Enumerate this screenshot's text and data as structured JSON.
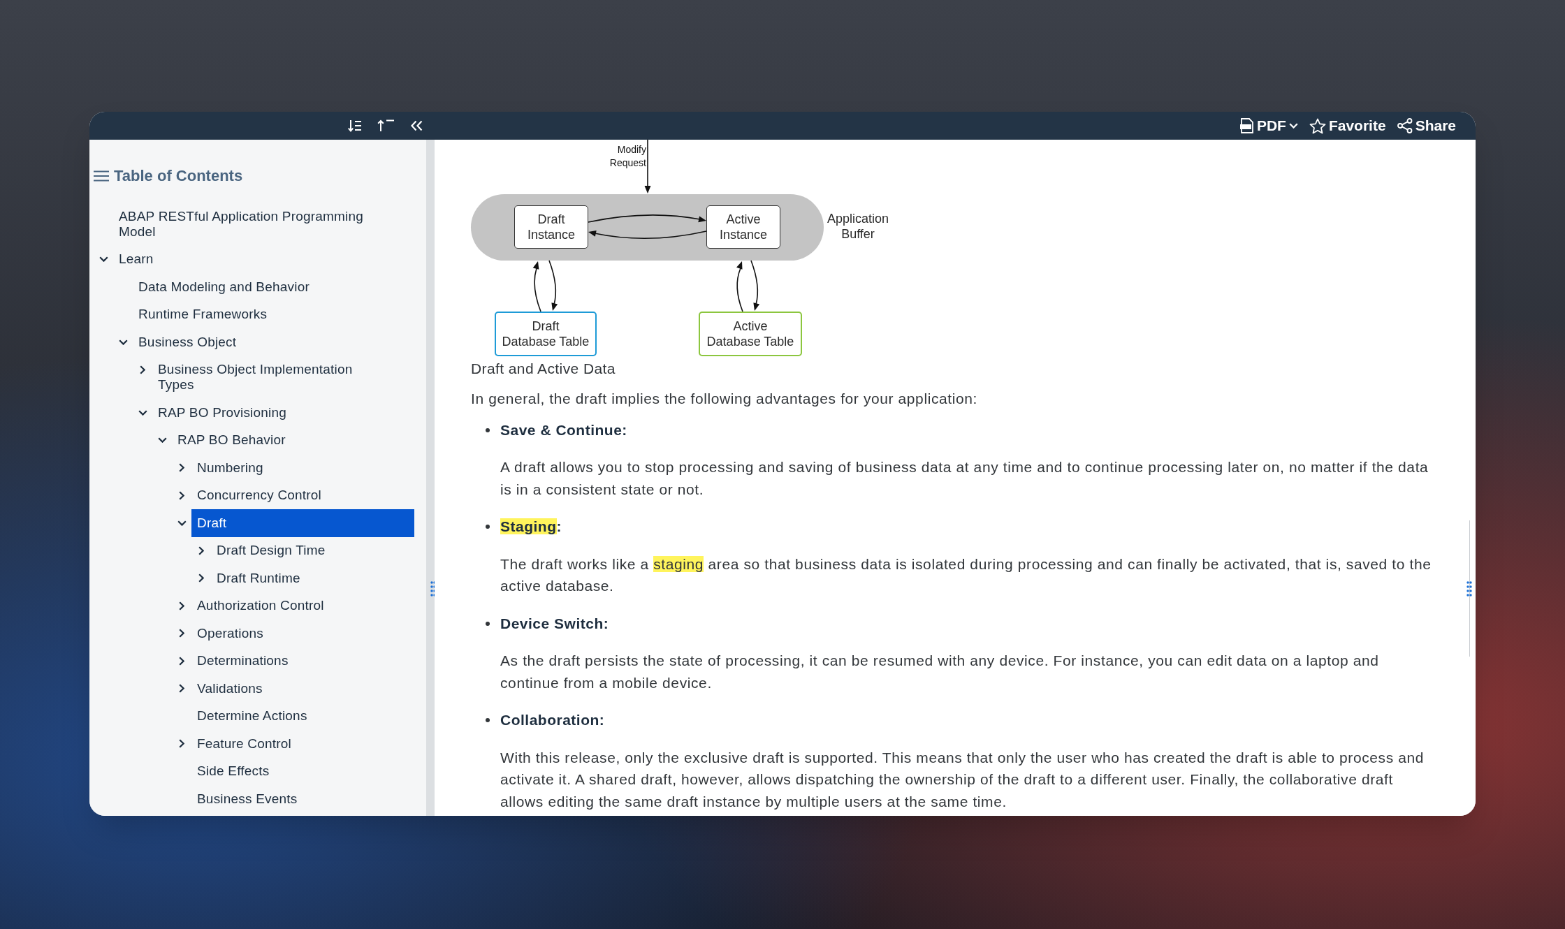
{
  "toolbar": {
    "buttons": [
      {
        "kind": "pdf",
        "label": "PDF"
      },
      {
        "kind": "favorite",
        "label": "Favorite",
        "on": false
      },
      {
        "kind": "share",
        "label": "Share"
      }
    ]
  },
  "toc": {
    "title": "Table of Contents",
    "items": [
      {
        "kind": "leaf",
        "label": "ABAP RESTful Application Programming Model",
        "selected": false
      },
      {
        "kind": "branch",
        "label": "Learn",
        "expanded": true,
        "selected": false,
        "children": [
          {
            "kind": "leaf",
            "label": "Data Modeling and Behavior",
            "selected": false
          },
          {
            "kind": "leaf",
            "label": "Runtime Frameworks",
            "selected": false
          },
          {
            "kind": "branch",
            "label": "Business Object",
            "expanded": true,
            "selected": false,
            "children": [
              {
                "kind": "branch",
                "label": "Business Object Implementation Types",
                "expanded": false,
                "selected": false
              },
              {
                "kind": "branch",
                "label": "RAP BO Provisioning",
                "expanded": true,
                "selected": false,
                "children": [
                  {
                    "kind": "branch",
                    "label": "RAP BO Behavior",
                    "expanded": true,
                    "selected": false,
                    "children": [
                      {
                        "kind": "branch",
                        "label": "Numbering",
                        "expanded": false,
                        "selected": false
                      },
                      {
                        "kind": "branch",
                        "label": "Concurrency Control",
                        "expanded": false,
                        "selected": false
                      },
                      {
                        "kind": "branch",
                        "label": "Draft",
                        "expanded": true,
                        "selected": true,
                        "children": [
                          {
                            "kind": "branch",
                            "label": "Draft Design Time",
                            "expanded": false,
                            "selected": false
                          },
                          {
                            "kind": "branch",
                            "label": "Draft Runtime",
                            "expanded": false,
                            "selected": false
                          }
                        ]
                      },
                      {
                        "kind": "branch",
                        "label": "Authorization Control",
                        "expanded": false,
                        "selected": false
                      },
                      {
                        "kind": "branch",
                        "label": "Operations",
                        "expanded": false,
                        "selected": false
                      },
                      {
                        "kind": "branch",
                        "label": "Determinations",
                        "expanded": false,
                        "selected": false
                      },
                      {
                        "kind": "branch",
                        "label": "Validations",
                        "expanded": false,
                        "selected": false
                      },
                      {
                        "kind": "leaf",
                        "label": "Determine Actions",
                        "selected": false
                      },
                      {
                        "kind": "branch",
                        "label": "Feature Control",
                        "expanded": false,
                        "selected": false
                      },
                      {
                        "kind": "leaf",
                        "label": "Side Effects",
                        "selected": false
                      },
                      {
                        "kind": "leaf",
                        "label": "Business Events",
                        "selected": false
                      }
                    ]
                  }
                ]
              }
            ]
          }
        ]
      }
    ]
  },
  "figure": {
    "request_label": "Modify\nRequest",
    "buffer_label": "Application\nBuffer",
    "instances": [
      {
        "label": "Draft\nInstance"
      },
      {
        "label": "Active\nInstance"
      }
    ],
    "tables": [
      {
        "label": "Draft\nDatabase Table",
        "color": "#1e9bd7"
      },
      {
        "label": "Active\nDatabase Table",
        "color": "#8cc63f"
      }
    ],
    "caption": "Draft and Active Data"
  },
  "article": {
    "intro": "In general, the draft implies the following advantages for your application:",
    "advantages": [
      {
        "title_parts": [
          {
            "text": "Save & Continue:",
            "highlighted": false
          }
        ],
        "text_parts": [
          {
            "text": "A draft allows you to stop processing and saving of business data at any time and to continue processing later on, no matter if the data is in a consistent state or not.",
            "highlighted": false
          }
        ]
      },
      {
        "title_parts": [
          {
            "text": "Staging",
            "highlighted": true
          },
          {
            "text": ":",
            "highlighted": false
          }
        ],
        "text_parts": [
          {
            "text": "The draft works like a ",
            "highlighted": false
          },
          {
            "text": "staging",
            "highlighted": true
          },
          {
            "text": " area so that business data is isolated during processing and can finally be activated, that is, saved to the active database.",
            "highlighted": false
          }
        ]
      },
      {
        "title_parts": [
          {
            "text": "Device Switch:",
            "highlighted": false
          }
        ],
        "text_parts": [
          {
            "text": "As the draft persists the state of processing, it can be resumed with any device. For instance, you can edit data on a laptop and continue from a mobile device.",
            "highlighted": false
          }
        ]
      },
      {
        "title_parts": [
          {
            "text": "Collaboration:",
            "highlighted": false
          }
        ],
        "text_parts": [
          {
            "text": "With this release, only the exclusive draft is supported. This means that only the user who has created the draft is able to process and activate it. A shared draft, however, allows dispatching the ownership of the draft to a different user. Finally, the collaborative draft allows editing the same draft instance by multiple users at the same time.",
            "highlighted": false
          }
        ]
      }
    ]
  }
}
